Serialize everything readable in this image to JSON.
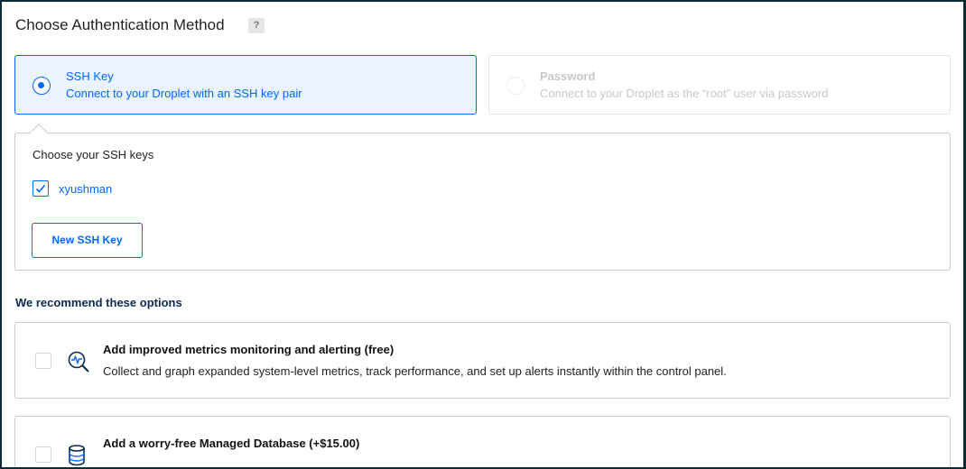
{
  "section": {
    "title": "Choose Authentication Method",
    "help": "?"
  },
  "auth_options": {
    "ssh": {
      "title": "SSH Key",
      "subtitle": "Connect to your Droplet with an SSH key pair",
      "selected": true
    },
    "password": {
      "title": "Password",
      "subtitle": "Connect to your Droplet as the “root” user via password",
      "selected": false
    }
  },
  "ssh_keys": {
    "label": "Choose your SSH keys",
    "keys": [
      {
        "name": "xyushman",
        "checked": true
      }
    ],
    "new_key_button": "New SSH Key"
  },
  "recommend": {
    "heading": "We recommend these options",
    "options": [
      {
        "title": "Add improved metrics monitoring and alerting (free)",
        "description": "Collect and graph expanded system-level metrics, track performance, and set up alerts instantly within the control panel.",
        "icon": "metrics-icon",
        "checked": false
      },
      {
        "title": "Add a worry-free Managed Database (+$15.00)",
        "description": "",
        "icon": "database-icon",
        "checked": false
      }
    ]
  },
  "colors": {
    "accent": "#0069ff",
    "selected_bg": "#eaf3ff",
    "border": "#c8ccd0",
    "disabled_text": "#c8c8c8",
    "heading_navy": "#0b2a52"
  }
}
